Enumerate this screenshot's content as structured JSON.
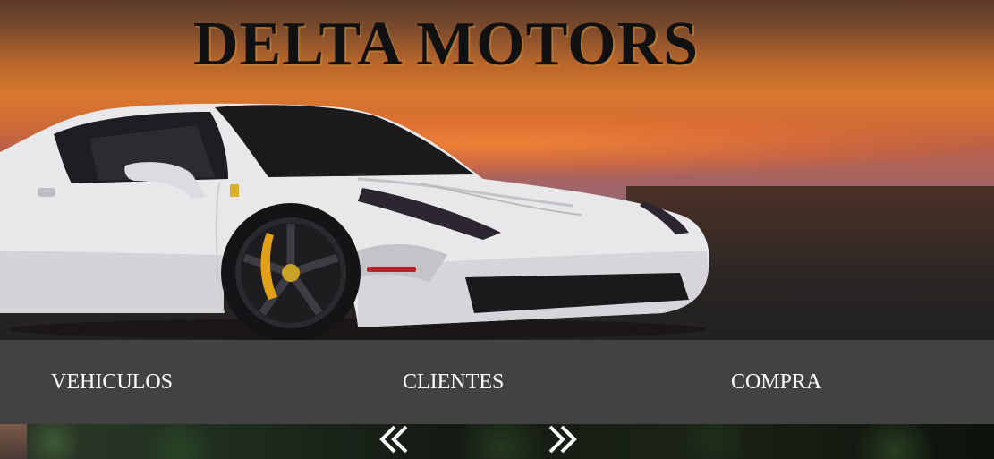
{
  "header": {
    "title": "DELTA MOTORS"
  },
  "hero": {
    "image": "white sports car at sunset"
  },
  "nav": {
    "items": [
      {
        "label": "VEHICULOS"
      },
      {
        "label": "CLIENTES"
      },
      {
        "label": "COMPRA"
      }
    ]
  },
  "carousel": {
    "prev_icon": "double-chevron-left-icon",
    "next_icon": "double-chevron-right-icon"
  },
  "colors": {
    "nav_background": "#424242",
    "nav_text": "#ffffff",
    "title_text": "#111111"
  }
}
